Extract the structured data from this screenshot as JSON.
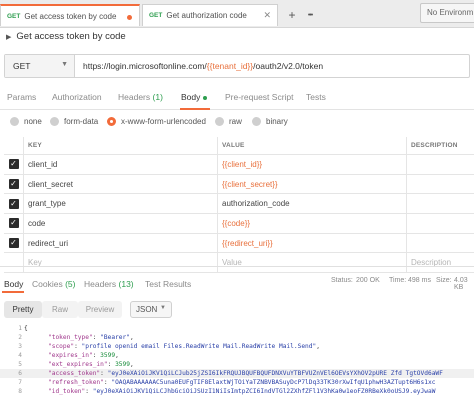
{
  "tabs": [
    {
      "method": "GET",
      "label": "Get access token by code",
      "active": true
    },
    {
      "method": "GET",
      "label": "Get authorization code",
      "active": false
    }
  ],
  "tab_actions": {
    "new": "+",
    "more": "•••"
  },
  "environment": {
    "label": "No Environm"
  },
  "request": {
    "name": "Get access token by code",
    "method": "GET",
    "url_prefix": "https://login.microsoftonline.com/",
    "url_var": "{{tenant_id}}",
    "url_suffix": "/oauth2/v2.0/token"
  },
  "request_tabs": [
    {
      "label": "Params"
    },
    {
      "label": "Authorization"
    },
    {
      "label": "Headers",
      "count": "(1)"
    },
    {
      "label": "Body"
    },
    {
      "label": "Pre-request Script"
    },
    {
      "label": "Tests"
    }
  ],
  "body_types": [
    {
      "label": "none",
      "selected": false
    },
    {
      "label": "form-data",
      "selected": false
    },
    {
      "label": "x-www-form-urlencoded",
      "selected": true
    },
    {
      "label": "raw",
      "selected": false
    },
    {
      "label": "binary",
      "selected": false
    }
  ],
  "params_table": {
    "headers": {
      "key": "KEY",
      "value": "VALUE",
      "description": "DESCRIPTION"
    },
    "rows": [
      {
        "key": "client_id",
        "value": "{{client_id}}",
        "value_is_var": true
      },
      {
        "key": "client_secret",
        "value": "{{client_secret}}",
        "value_is_var": true
      },
      {
        "key": "grant_type",
        "value": "authorization_code",
        "value_is_var": false
      },
      {
        "key": "code",
        "value": "{{code}}",
        "value_is_var": true
      },
      {
        "key": "redirect_uri",
        "value": "{{redirect_uri}}",
        "value_is_var": true
      }
    ],
    "placeholder": {
      "key": "Key",
      "value": "Value",
      "description": "Description"
    }
  },
  "response_tabs": [
    {
      "label": "Body"
    },
    {
      "label": "Cookies",
      "count": "(5)"
    },
    {
      "label": "Headers",
      "count": "(13)"
    },
    {
      "label": "Test Results"
    }
  ],
  "response_status": {
    "status_label": "Status:",
    "status": "200 OK",
    "time_label": "Time:",
    "time": "498 ms",
    "size_label": "Size:",
    "size": "4.03 KB"
  },
  "format_bar": {
    "pretty": "Pretty",
    "raw": "Raw",
    "preview": "Preview",
    "format": "JSON"
  },
  "code_lines": [
    {
      "n": "1",
      "text": "{"
    },
    {
      "n": "2",
      "key": "\"token_type\"",
      "val": "\"Bearer\"",
      "kind": "s"
    },
    {
      "n": "3",
      "key": "\"scope\"",
      "val": "\"profile openid email Files.ReadWrite Mail.ReadWrite Mail.Send\"",
      "kind": "s"
    },
    {
      "n": "4",
      "key": "\"expires_in\"",
      "val": "3599",
      "kind": "n"
    },
    {
      "n": "5",
      "key": "\"ext_expires_in\"",
      "val": "3599",
      "kind": "n"
    },
    {
      "n": "6",
      "key": "\"access_token\"",
      "val": "\"eyJ0eXAiOiJKV1QiLCJub25jZSI6IkFRQUJBQUFBQUFDNXVuYTBFVUZnVEl6OEVsYXhOV2pURE Zfd TgtOVd6aWF",
      "kind": "s"
    },
    {
      "n": "7",
      "key": "\"refresh_token\"",
      "val": "\"OAQABAAAAAAC5una0EUFgTIF8ElaxtWjTOiYaTZNBVBASuyDcP7lDq33TK30rXwIfqU1phwH3AZTupt6H6s1xc",
      "kind": "s"
    },
    {
      "n": "8",
      "key": "\"id_token\"",
      "val": "\"eyJ0eXAiOiJKV1QiLCJhbGciOiJSUzI1NiIsImtpZCI6IndVTGl2ZXhfZFl1V3hKa0w1eoFZ0RBeXk0oUSJ9.eyJwaW",
      "kind": "s"
    }
  ]
}
